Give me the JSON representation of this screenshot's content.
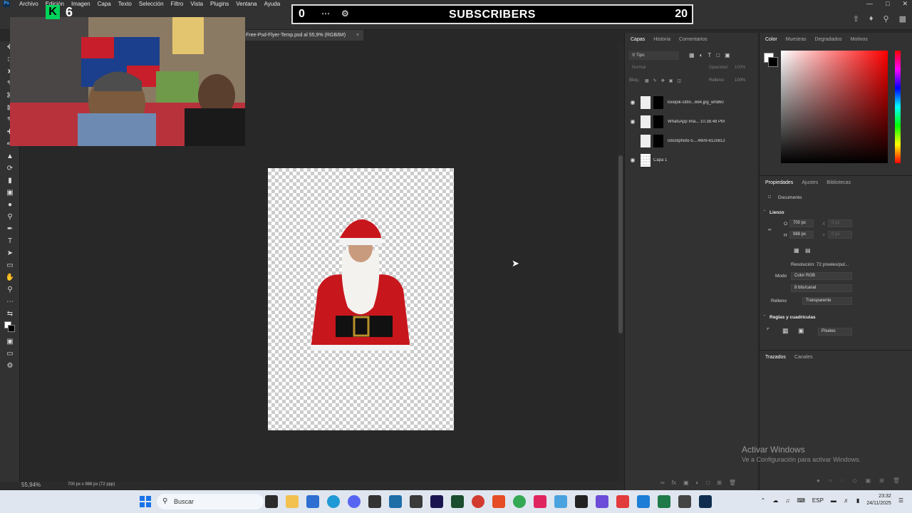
{
  "menubar": {
    "app_icon": "Ps",
    "items": [
      "Archivo",
      "Edición",
      "Imagen",
      "Capa",
      "Texto",
      "Selección",
      "Filtro",
      "Vista",
      "Plugins",
      "Ventana",
      "Ayuda"
    ]
  },
  "overlay": {
    "subscriber_count": "0",
    "subscriber_label": "SUBSCRIBERS",
    "subscriber_goal": "20",
    "kick_logo": "K",
    "kick_count": "6"
  },
  "document": {
    "tab_title": "Free-Psd-Flyer-Temp.psd al 55,9% (RGB/8#)",
    "zoom": "55,94%",
    "dims": "700 px x 988 px (72 ppp)"
  },
  "layers_panel": {
    "tabs": [
      "Capas",
      "Historia",
      "Comentarios"
    ],
    "filter_label": "Tipo",
    "blend_mode": "Normal",
    "opacity_label": "Opacidad:",
    "opacity_value": "100%",
    "lock_label": "Bloq.:",
    "fill_label": "Relleno:",
    "fill_value": "100%",
    "layers": [
      {
        "name": "lovepik-sittin...664.jpg_wh860",
        "visible": true
      },
      {
        "name": "WhatsApp Ima... 10.38.48 PM",
        "visible": true
      },
      {
        "name": "istockphoto-5....4609-612x612",
        "visible": false
      },
      {
        "name": "Capa 1",
        "visible": true
      }
    ]
  },
  "color_panel": {
    "tabs": [
      "Color",
      "Muestras",
      "Degradados",
      "Motivos"
    ]
  },
  "properties_panel": {
    "tabs": [
      "Propiedades",
      "Ajustes",
      "Bibliotecas"
    ],
    "doc_label": "Documento",
    "canvas_section": "Lienzo",
    "width_label": "O",
    "width_value": "700 px",
    "height_label": "H",
    "height_value": "988 px",
    "x_label": "X",
    "x_value": "0 px",
    "y_label": "Y",
    "y_value": "0 px",
    "resolution": "Resolución: 72 píxeles/pul...",
    "mode_label": "Modo",
    "mode_value": "Color RGB",
    "bits_value": "8 bits/canal",
    "fill_label": "Relleno",
    "fill_value": "Transparente",
    "rulers_section": "Reglas y cuadrículas",
    "units_value": "Píxeles"
  },
  "paths_panel": {
    "tabs": [
      "Trazados",
      "Canales"
    ]
  },
  "watermark": {
    "line1": "Activar Windows",
    "line2": "Ve a Configuración para activar Windows."
  },
  "taskbar": {
    "search_placeholder": "Buscar",
    "language": "ESP",
    "time": "23:32",
    "date": "24/11/2025"
  }
}
